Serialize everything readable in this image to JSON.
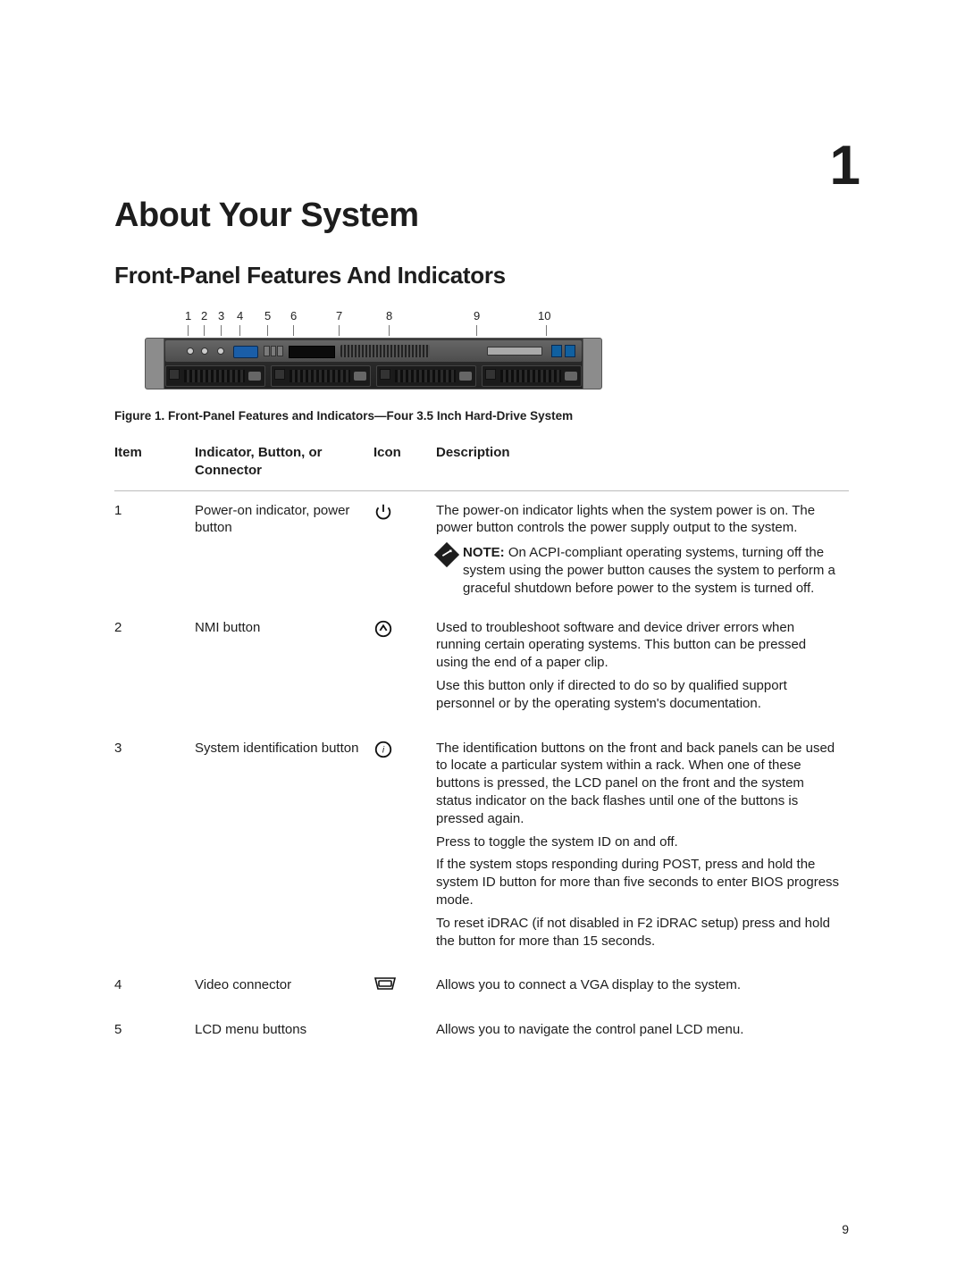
{
  "chapter_number": "1",
  "page_number": "9",
  "title": "About Your System",
  "subtitle": "Front-Panel Features And Indicators",
  "callout_labels": [
    "1",
    "2",
    "3",
    "4",
    "5",
    "6",
    "7",
    "8",
    "9",
    "10"
  ],
  "figure_caption": "Figure 1. Front-Panel Features and Indicators—Four 3.5 Inch Hard-Drive System",
  "table": {
    "headers": {
      "item": "Item",
      "indicator": "Indicator, Button, or Connector",
      "icon": "Icon",
      "description": "Description"
    },
    "rows": [
      {
        "item": "1",
        "indicator": "Power-on indicator, power button",
        "icon": "power-icon",
        "desc_p1": "The power-on indicator lights when the system power is on. The power button controls the power supply output to the system.",
        "note_label": "NOTE:",
        "note_text": " On ACPI-compliant operating systems, turning off the system using the power button causes the system to perform a graceful shutdown before power to the system is turned off."
      },
      {
        "item": "2",
        "indicator": "NMI button",
        "icon": "nmi-icon",
        "desc_p1": "Used to troubleshoot software and device driver errors when running certain operating systems. This button can be pressed using the end of a paper clip.",
        "desc_p2": "Use this button only if directed to do so by qualified support personnel or by the operating system's documentation."
      },
      {
        "item": "3",
        "indicator": "System identification button",
        "icon": "id-icon",
        "desc_p1": "The identification buttons on the front and back panels can be used to locate a particular system within a rack. When one of these buttons is pressed, the LCD panel on the front and the system status indicator on the back flashes until one of the buttons is pressed again.",
        "desc_p2": "Press to toggle the system ID on and off.",
        "desc_p3": "If the system stops responding during POST, press and hold the system ID button for more than five seconds to enter BIOS progress mode.",
        "desc_p4": "To reset iDRAC (if not disabled in F2 iDRAC setup) press and hold the button for more than 15 seconds."
      },
      {
        "item": "4",
        "indicator": "Video connector",
        "icon": "vga-icon",
        "desc_p1": "Allows you to connect a VGA display to the system."
      },
      {
        "item": "5",
        "indicator": "LCD menu buttons",
        "icon": "",
        "desc_p1": "Allows you to navigate the control panel LCD menu."
      }
    ]
  }
}
